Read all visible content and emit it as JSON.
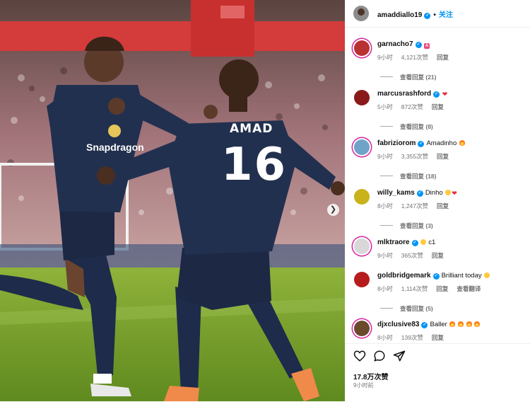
{
  "header": {
    "username": "amaddiallo19",
    "follow_label": "关注"
  },
  "photo": {
    "shirt_name": "AMAD",
    "shirt_number": "16",
    "sponsor": "Snapdragon"
  },
  "comments": [
    {
      "username": "garnacho7",
      "verified": true,
      "text": "",
      "emoji": [
        "tag"
      ],
      "time": "9小时",
      "likes": "4,121次赞",
      "reply": "回复",
      "translate": "",
      "view_replies": "查看回复 (21)",
      "avatar_color": "#b83232"
    },
    {
      "username": "marcusrashford",
      "verified": true,
      "text": "",
      "emoji": [
        "red-heart"
      ],
      "time": "5小时",
      "likes": "872次赞",
      "reply": "回复",
      "translate": "",
      "view_replies": "查看回复 (8)",
      "avatar_color": "#8a1a1a"
    },
    {
      "username": "fabriziorom",
      "verified": true,
      "text": "Amadinho",
      "emoji": [
        "fire"
      ],
      "time": "9小时",
      "likes": "3,355次赞",
      "reply": "回复",
      "translate": "",
      "view_replies": "查看回复 (18)",
      "avatar_color": "#6fa3c7"
    },
    {
      "username": "willy_kams",
      "verified": true,
      "text": "Dinho",
      "emoji": [
        "laugh",
        "red-heart"
      ],
      "time": "8小时",
      "likes": "1,247次赞",
      "reply": "回复",
      "translate": "",
      "view_replies": "查看回复 (3)",
      "avatar_color": "#c9b21a"
    },
    {
      "username": "mlktraore",
      "verified": true,
      "text": "c1",
      "emoji": [
        "salute"
      ],
      "time": "9小时",
      "likes": "365次赞",
      "reply": "回复",
      "translate": "",
      "view_replies": "",
      "avatar_color": "#d8d8d8"
    },
    {
      "username": "goldbridgemark",
      "verified": true,
      "text": "Brilliant today",
      "emoji": [
        "salute"
      ],
      "time": "8小时",
      "likes": "1,114次赞",
      "reply": "回复",
      "translate": "查看翻译",
      "view_replies": "查看回复 (5)",
      "avatar_color": "#b71c1c"
    },
    {
      "username": "djxclusive83",
      "verified": true,
      "text": "Baller",
      "emoji": [
        "fire",
        "fire",
        "fire",
        "fire"
      ],
      "time": "8小时",
      "likes": "139次赞",
      "reply": "回复",
      "translate": "",
      "view_replies": "",
      "avatar_color": "#6a4a2a"
    }
  ],
  "actions": {
    "likes_count": "17.8万次赞",
    "post_time": "9小时前"
  },
  "colors": {
    "accent": "#0095f6",
    "story_ring": "#d6249f",
    "kit_navy": "#1e2b4a"
  },
  "icons": [
    "heart-icon",
    "comment-icon",
    "share-icon",
    "verified-icon",
    "chevron-right-icon"
  ]
}
